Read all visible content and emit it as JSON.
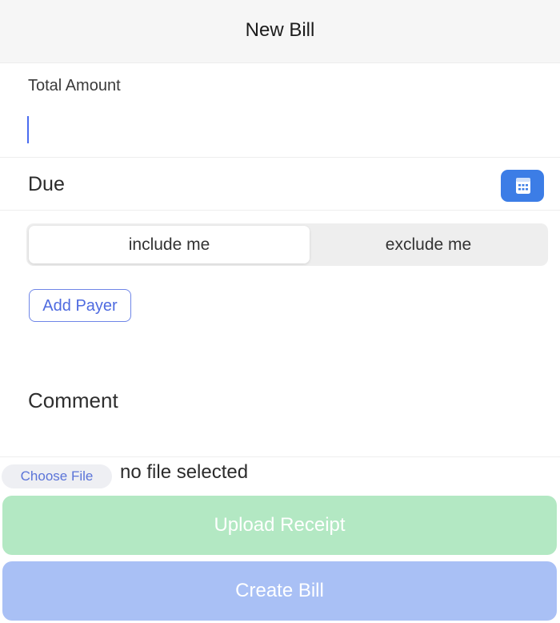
{
  "header": {
    "title": "New Bill"
  },
  "amount": {
    "label": "Total Amount",
    "value": ""
  },
  "due": {
    "label": "Due",
    "calendar_icon": "calendar-icon"
  },
  "payer_mode": {
    "options": [
      "include me",
      "exclude me"
    ],
    "selected": "include me"
  },
  "add_payer": {
    "label": "Add Payer"
  },
  "comment": {
    "label": "Comment",
    "value": ""
  },
  "file": {
    "button_label": "Choose File",
    "status": "no file selected"
  },
  "actions": {
    "upload_label": "Upload Receipt",
    "create_label": "Create Bill"
  },
  "colors": {
    "accent_blue": "#3c7de6",
    "upload_green": "#b3e8c3",
    "create_blue": "#a9c0f5",
    "link_blue": "#4f6be0"
  }
}
